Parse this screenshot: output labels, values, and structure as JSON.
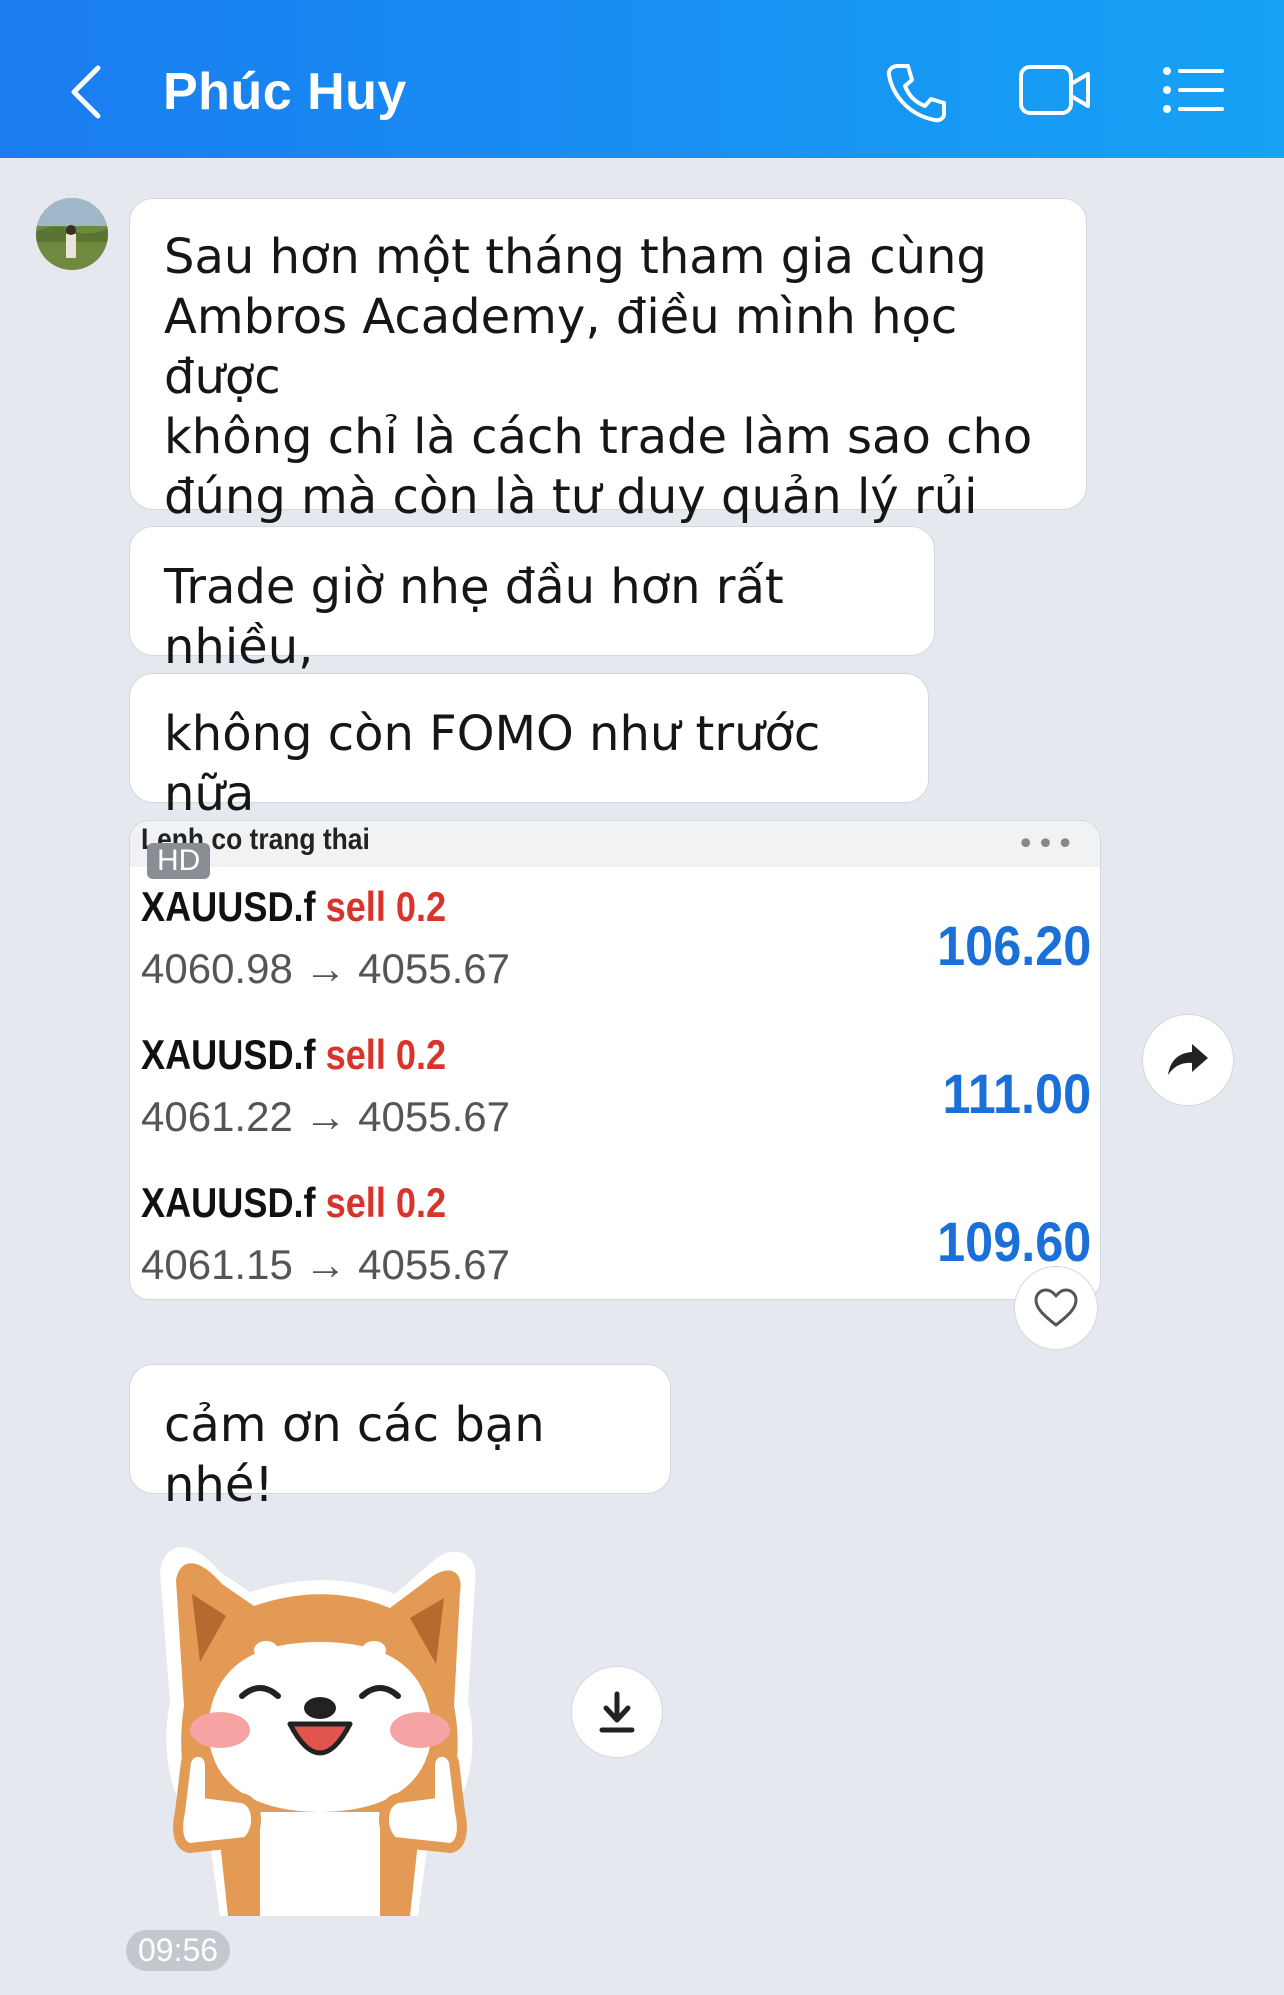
{
  "header": {
    "title": "Phúc Huy",
    "icons": [
      "back-chevron-icon",
      "phone-icon",
      "video-camera-icon",
      "list-menu-icon"
    ]
  },
  "messages": [
    {
      "text": "Sau hơn một tháng tham gia cùng\nAmbros Academy, điều mình học được\nkhông chỉ là cách trade làm sao cho\nđúng mà còn là tư duy quản lý rủi ro."
    },
    {
      "text": "Trade giờ nhẹ đầu hơn rất nhiều,"
    },
    {
      "text": "không còn FOMO như trước nữa"
    },
    {
      "text": "cảm ơn các bạn nhé!"
    }
  ],
  "image_card": {
    "title": "Lenh co trang thai",
    "badge": "HD",
    "menu": "•••",
    "trades": [
      {
        "symbol": "XAUUSD.f",
        "side": "sell 0.2",
        "prices": "4060.98 → 4055.67",
        "profit": "106.20"
      },
      {
        "symbol": "XAUUSD.f",
        "side": "sell 0.2",
        "prices": "4061.22 → 4055.67",
        "profit": "111.00"
      },
      {
        "symbol": "XAUUSD.f",
        "side": "sell 0.2",
        "prices": "4061.15 → 4055.67",
        "profit": "109.60"
      }
    ]
  },
  "timestamp": "09:56",
  "colors": {
    "header_start": "#1a7cf0",
    "header_end": "#16a2f5",
    "chat_bg": "#e5e8ee",
    "sell_red": "#d9342b",
    "profit_blue": "#1a6fd8"
  }
}
